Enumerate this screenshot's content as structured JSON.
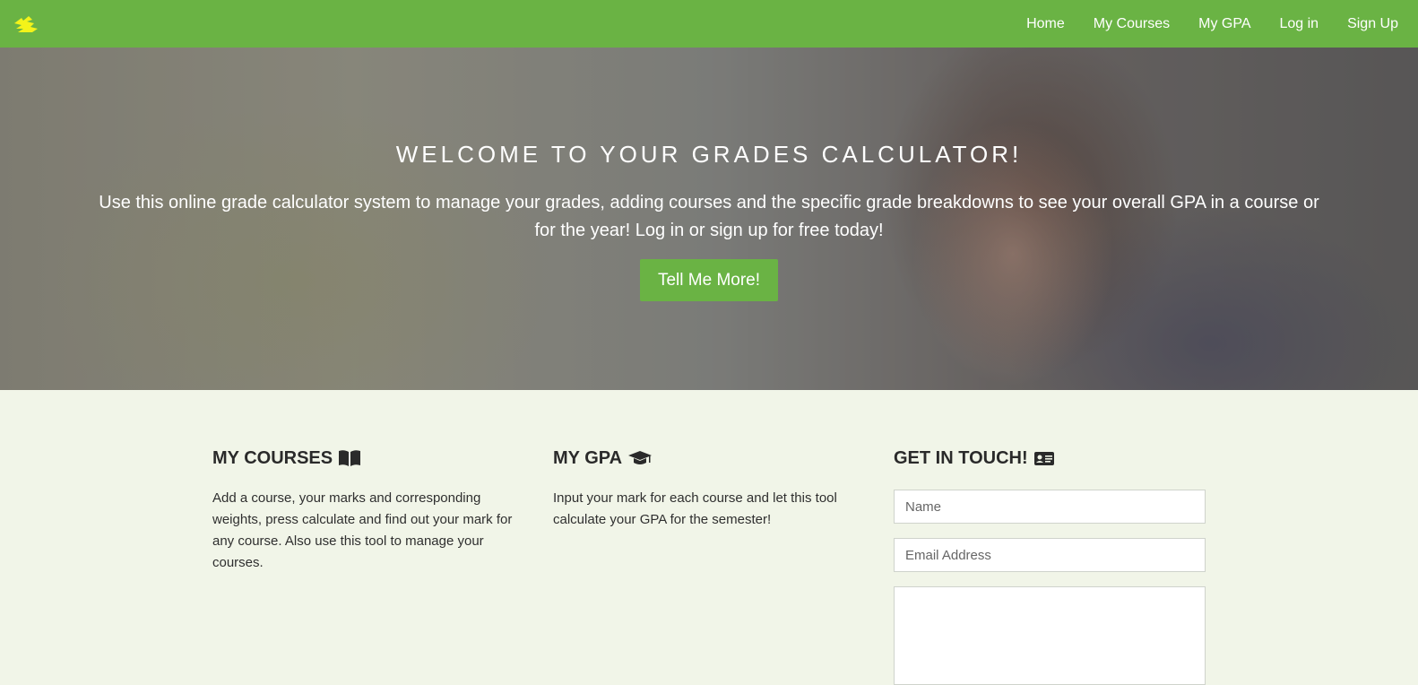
{
  "nav": {
    "logo_icon": "bird-logo-icon",
    "links": [
      "Home",
      "My Courses",
      "My GPA",
      "Log in",
      "Sign Up"
    ]
  },
  "hero": {
    "title": "WELCOME TO YOUR GRADES CALCULATOR!",
    "text": "Use this online grade calculator system to manage your grades, adding courses and the specific grade breakdowns to see your overall GPA in a course or for the year! Log in or sign up for free today!",
    "button": "Tell Me More!"
  },
  "sections": {
    "courses": {
      "title": "MY COURSES",
      "icon": "open-book-icon",
      "text": "Add a course, your marks and corresponding weights, press calculate and find out your mark for any course. Also use this tool to manage your courses."
    },
    "gpa": {
      "title": "MY GPA",
      "icon": "graduation-cap-icon",
      "text": "Input your mark for each course and let this tool calculate your GPA for the semester!"
    },
    "contact": {
      "title": "GET IN TOUCH!",
      "icon": "contact-card-icon",
      "name_placeholder": "Name",
      "email_placeholder": "Email Address",
      "message_placeholder": ""
    }
  },
  "colors": {
    "nav_bg": "#6ab344",
    "accent": "#6ab344",
    "logo": "#f3f31a",
    "page_bg": "#f1f5e8"
  }
}
